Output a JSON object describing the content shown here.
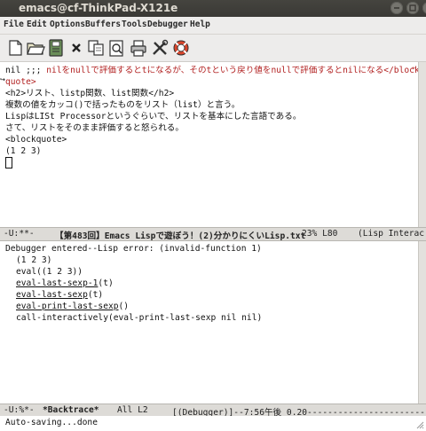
{
  "window": {
    "title": "emacs@cf-ThinkPad-X121e"
  },
  "menubar": {
    "items": [
      "File",
      "Edit",
      "Options",
      "Buffers",
      "Tools",
      "Debugger",
      "Help"
    ]
  },
  "toolbar": {
    "icons": [
      "new-file-icon",
      "open-folder-icon",
      "save-icon",
      "close-buffer-icon",
      "copy-icon",
      "paste-icon",
      "print-icon",
      "preferences-icon",
      "help-icon"
    ]
  },
  "editor": {
    "lines": {
      "l1a": "nil ;;; ",
      "l1b": "nilをnullで評価するとtになるが、そのtという戻り値をnullで評価するとnilになる</block",
      "l2": "quote>",
      "l3": "<h2>リスト、listp関数、list関数</h2>",
      "l4": "複数の値をカッコ()で括ったものをリスト（list）と言う。",
      "l5": "LispはLISt Processorというぐらいで、リストを基本にした言語である。",
      "l6": "さて、リストをそのまま評価すると怒られる。",
      "l7": "<blockquote>",
      "l8": "(1 2 3)"
    },
    "modeline": {
      "status": "-U:**-",
      "buffer": "【第483回】Emacs Lispで遊ぼう！(2)分かりにくいLisp.txt",
      "position": "23% L80",
      "mode": "(Lisp Interac"
    }
  },
  "backtrace": {
    "lines": {
      "b1": "Debugger entered--Lisp error: (invalid-function 1)",
      "b2": "(1 2 3)",
      "b3": "eval((1 2 3))",
      "b4fn": "eval-last-sexp-1",
      "b4rest": "(t)",
      "b5fn": "eval-last-sexp",
      "b5rest": "(t)",
      "b6fn": "eval-print-last-sexp",
      "b6rest": "()",
      "b7": "call-interactively(eval-print-last-sexp nil nil)"
    },
    "modeline": {
      "status": "-U:%*-",
      "buffer": "*Backtrace*",
      "position": "All L2",
      "mode": "[(Debugger)]--7:56午後 0.20------------------------------"
    }
  },
  "minibuffer": {
    "message": "Auto-saving...done"
  },
  "colors": {
    "string_red": "#b22222",
    "titlebar": "#3c3b37",
    "modeline": "#dddbd7"
  }
}
